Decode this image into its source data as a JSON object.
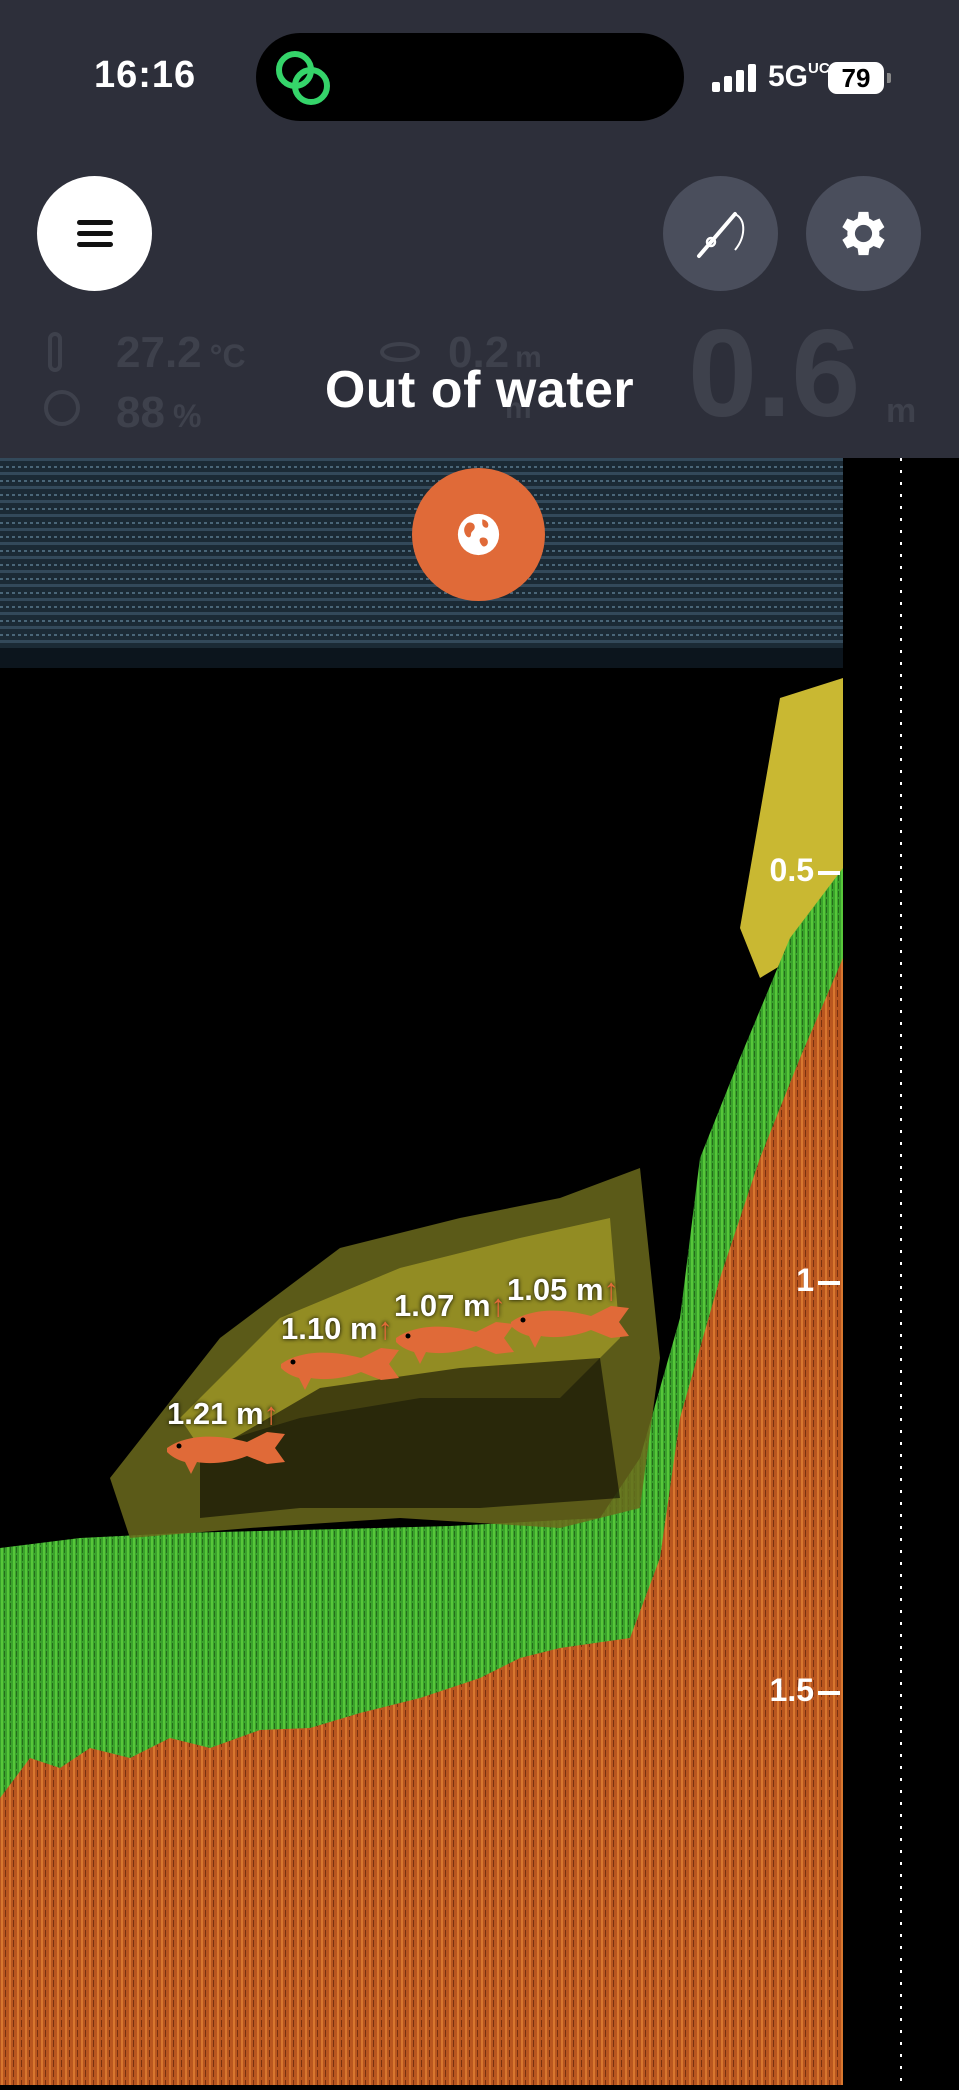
{
  "status_bar": {
    "time": "16:16",
    "network": "5G",
    "network_sup": "UC",
    "battery": "79"
  },
  "readings": {
    "temperature": "27.2",
    "temperature_unit": "°C",
    "humidity": "88",
    "humidity_unit": "%",
    "top_depth": "0.2",
    "top_depth_unit": "m",
    "second_value_unit": "m",
    "depth": "0.6",
    "depth_unit": "m"
  },
  "status_message": "Out of water",
  "depth_scale": [
    "0.5",
    "1",
    "1.5"
  ],
  "fish": [
    {
      "depth_label": "1.21 m",
      "arrow": "↑"
    },
    {
      "depth_label": "1.10 m",
      "arrow": "↑"
    },
    {
      "depth_label": "1.07 m",
      "arrow": "↑"
    },
    {
      "depth_label": "1.05 m",
      "arrow": "↑"
    }
  ],
  "colors": {
    "accent": "#e06a38",
    "header_bg": "#2d2f3a",
    "bottom": "#c4602a",
    "vegetation": "#3fae32",
    "fish_echo": "#cfc23a"
  },
  "icons": {
    "menu": "hamburger-icon",
    "rod": "fishing-rod-icon",
    "settings": "gear-icon",
    "map": "globe-icon"
  }
}
